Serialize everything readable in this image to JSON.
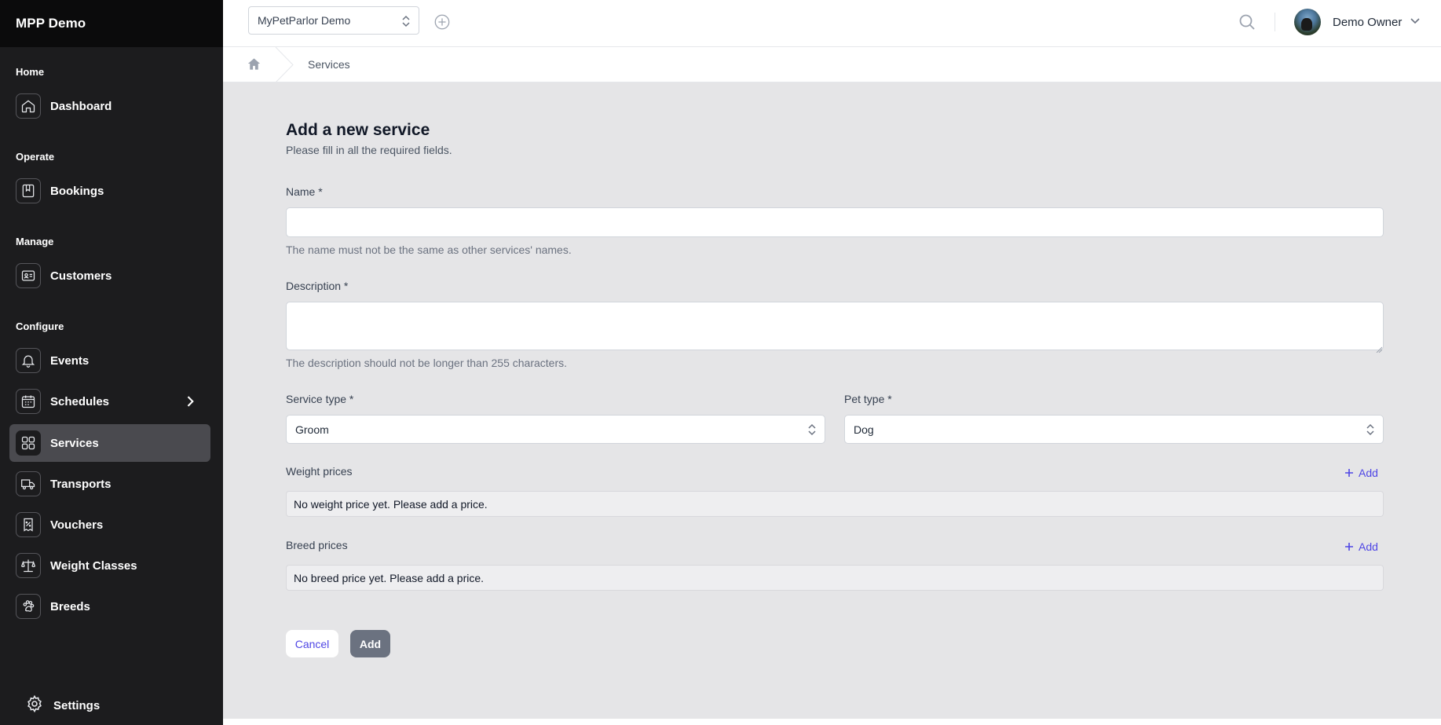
{
  "sidebar": {
    "brand": "MPP Demo",
    "sections": {
      "home": "Home",
      "operate": "Operate",
      "manage": "Manage",
      "configure": "Configure"
    },
    "items": {
      "dashboard": "Dashboard",
      "bookings": "Bookings",
      "customers": "Customers",
      "events": "Events",
      "schedules": "Schedules",
      "services": "Services",
      "transports": "Transports",
      "vouchers": "Vouchers",
      "weight_classes": "Weight Classes",
      "breeds": "Breeds"
    },
    "active_item": "Services",
    "settings_label": "Settings"
  },
  "topbar": {
    "org_select_value": "MyPetParlor Demo",
    "user_name": "Demo Owner"
  },
  "breadcrumb": {
    "current": "Services"
  },
  "form": {
    "title": "Add a new service",
    "subtitle": "Please fill in all the required fields.",
    "name_label": "Name *",
    "name_value": "",
    "name_hint": "The name must not be the same as other services' names.",
    "description_label": "Description *",
    "description_value": "",
    "description_hint": "The description should not be longer than 255 characters.",
    "service_type_label": "Service type *",
    "service_type_value": "Groom",
    "pet_type_label": "Pet type *",
    "pet_type_value": "Dog",
    "weight_prices_label": "Weight prices",
    "weight_prices_add": "Add",
    "weight_prices_empty": "No weight price yet. Please add a price.",
    "breed_prices_label": "Breed prices",
    "breed_prices_add": "Add",
    "breed_prices_empty": "No breed price yet. Please add a price.",
    "cancel_label": "Cancel",
    "submit_label": "Add"
  },
  "colors": {
    "sidebar_bg": "#1c1c1e",
    "brand_bg": "#0b0b0c",
    "active_item_bg": "#4a4a4f",
    "accent": "#4f46e5",
    "page_bg": "#e5e5e7",
    "submit_bg": "#6b7280"
  },
  "icons": {
    "dashboard": "home-icon",
    "bookings": "bookmark-book-icon",
    "customers": "id-card-icon",
    "events": "bell-icon",
    "schedules": "calendar-icon",
    "services": "grid-icon",
    "transports": "truck-icon",
    "vouchers": "voucher-percent-icon",
    "weight_classes": "scale-icon",
    "breeds": "paw-icon",
    "settings": "gear-icon"
  }
}
